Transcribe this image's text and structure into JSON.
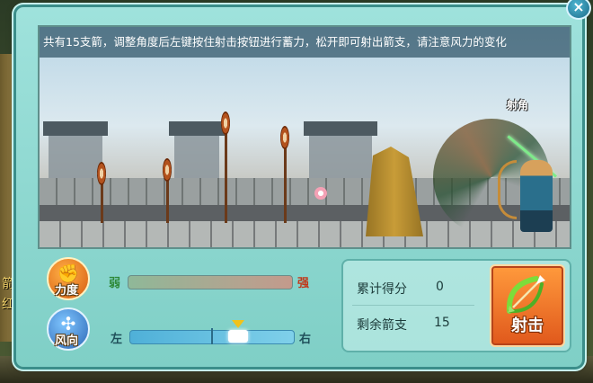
{
  "instructions": "共有15支箭，调整角度后左键按住射击按钮进行蓄力，松开即可射出箭支，请注意风力的变化",
  "angle_label": "射角",
  "power": {
    "label": "力度",
    "weak": "弱",
    "strong": "强",
    "level": 0
  },
  "wind": {
    "label": "风向",
    "left": "左",
    "right": "右",
    "position": 0.66
  },
  "score": {
    "total_label": "累计得分",
    "total_value": "0",
    "arrows_label": "剩余箭支",
    "arrows_value": "15"
  },
  "shoot_label": "射击",
  "close_symbol": "×",
  "side_text": [
    "箭",
    "红"
  ],
  "colors": {
    "panel": "#8fdad2",
    "shoot": "#f07a2a",
    "wind_bar": "#5fbfe2"
  }
}
